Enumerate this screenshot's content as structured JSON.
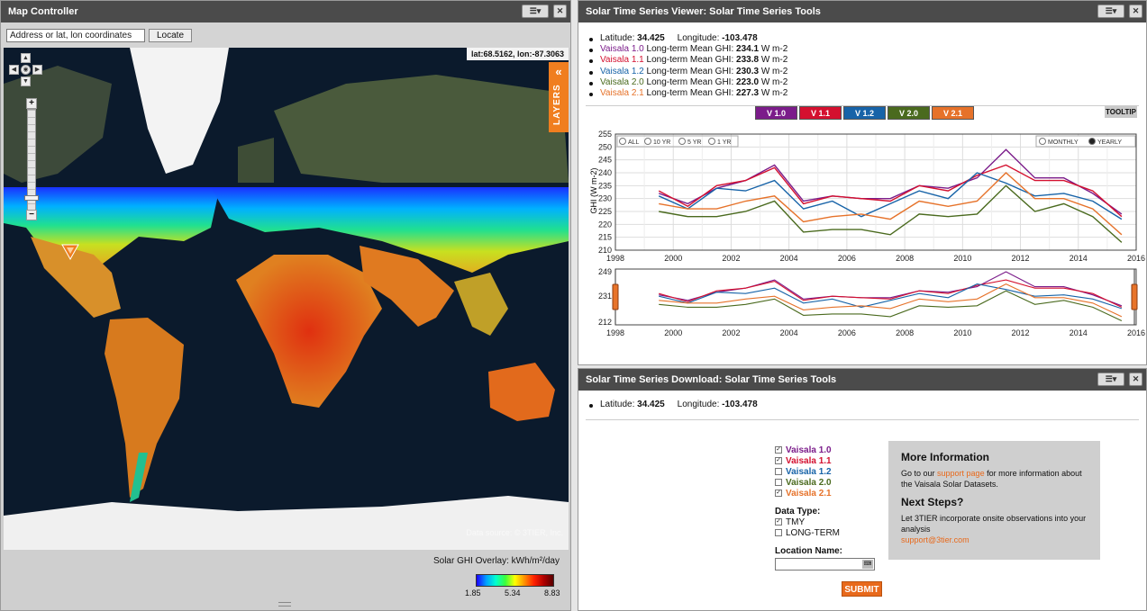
{
  "map_panel": {
    "title": "Map Controller",
    "search_placeholder": "Address or lat, lon coordinates",
    "locate_label": "Locate",
    "coord_readout": "lat:68.5162, lon:-87.3063",
    "layers_label": "LAYERS",
    "layers_chevron": "«",
    "zoom_in": "+",
    "zoom_out": "−",
    "data_source": "Data source: © 3TIER, Inc.",
    "legend": {
      "title": "Solar GHI Overlay: kWh/m²/day",
      "min": "1.85",
      "mid": "5.34",
      "max": "8.83"
    }
  },
  "viewer_panel": {
    "title": "Solar Time Series Viewer: Solar Time Series Tools",
    "latitude_label": "Latitude:",
    "latitude": "34.425",
    "longitude_label": "Longitude:",
    "longitude": "-103.478",
    "ghi_rows": [
      {
        "name": "Vaisala 1.0",
        "label": "Long-term Mean GHI:",
        "value": "234.1",
        "unit": "W m-2",
        "color": "#7b1c8a"
      },
      {
        "name": "Vaisala 1.1",
        "label": "Long-term Mean GHI:",
        "value": "233.8",
        "unit": "W m-2",
        "color": "#d4102f"
      },
      {
        "name": "Vaisala 1.2",
        "label": "Long-term Mean GHI:",
        "value": "230.3",
        "unit": "W m-2",
        "color": "#1763a8"
      },
      {
        "name": "Vaisala 2.0",
        "label": "Long-term Mean GHI:",
        "value": "223.0",
        "unit": "W m-2",
        "color": "#4a6a1e"
      },
      {
        "name": "Vaisala 2.1",
        "label": "Long-term Mean GHI:",
        "value": "227.3",
        "unit": "W m-2",
        "color": "#e6722a"
      }
    ],
    "version_buttons": [
      {
        "label": "V 1.0",
        "color": "#7b1c8a"
      },
      {
        "label": "V 1.1",
        "color": "#d4102f"
      },
      {
        "label": "V 1.2",
        "color": "#1763a8"
      },
      {
        "label": "V 2.0",
        "color": "#4a6a1e"
      },
      {
        "label": "V 2.1",
        "color": "#e6722a"
      }
    ],
    "tooltip_label": "TOOLTIP",
    "range_options": [
      "ALL",
      "10 YR",
      "5 YR",
      "1 YR"
    ],
    "period_options": [
      "MONTHLY",
      "YEARLY"
    ],
    "period_selected": "YEARLY"
  },
  "chart_data": {
    "type": "line",
    "ylabel": "GHI (W m-2)",
    "ylim": [
      210,
      255
    ],
    "yticks": [
      210,
      215,
      220,
      225,
      230,
      235,
      240,
      245,
      250,
      255
    ],
    "xlim": [
      1998,
      2016
    ],
    "xticks": [
      1998,
      2000,
      2002,
      2004,
      2006,
      2008,
      2010,
      2012,
      2014,
      2016
    ],
    "grid": true,
    "nav_yticks": [
      212,
      231,
      249
    ],
    "x": [
      1999.5,
      2000.5,
      2001.5,
      2002.5,
      2003.5,
      2004.5,
      2005.5,
      2006.5,
      2007.5,
      2008.5,
      2009.5,
      2010.5,
      2011.5,
      2012.5,
      2013.5,
      2014.5,
      2015.5
    ],
    "series": [
      {
        "name": "Vaisala 1.0",
        "color": "#7b1c8a",
        "values": [
          232,
          228,
          234,
          237,
          243,
          229,
          231,
          230,
          230,
          235,
          234,
          238,
          249,
          238,
          238,
          232,
          224
        ]
      },
      {
        "name": "Vaisala 1.1",
        "color": "#d4102f",
        "values": [
          233,
          227,
          235,
          237,
          242,
          228,
          231,
          230,
          229,
          235,
          233,
          239,
          243,
          237,
          237,
          233,
          223
        ]
      },
      {
        "name": "Vaisala 1.2",
        "color": "#1763a8",
        "values": [
          231,
          226,
          234,
          233,
          237,
          226,
          229,
          223,
          228,
          233,
          230,
          240,
          236,
          231,
          232,
          229,
          222
        ]
      },
      {
        "name": "Vaisala 2.0",
        "color": "#4a6a1e",
        "values": [
          225,
          223,
          223,
          225,
          229,
          217,
          218,
          218,
          216,
          224,
          223,
          224,
          235,
          225,
          228,
          223,
          213
        ]
      },
      {
        "name": "Vaisala 2.1",
        "color": "#e6722a",
        "values": [
          228,
          226,
          226,
          229,
          231,
          221,
          223,
          224,
          222,
          229,
          227,
          229,
          240,
          230,
          230,
          226,
          216
        ]
      }
    ]
  },
  "download_panel": {
    "title": "Solar Time Series Download: Solar Time Series Tools",
    "latitude_label": "Latitude:",
    "latitude": "34.425",
    "longitude_label": "Longitude:",
    "longitude": "-103.478",
    "datasets": [
      {
        "name": "Vaisala 1.0",
        "checked": true,
        "color": "#7b1c8a"
      },
      {
        "name": "Vaisala 1.1",
        "checked": true,
        "color": "#d4102f"
      },
      {
        "name": "Vaisala 1.2",
        "checked": false,
        "color": "#1763a8"
      },
      {
        "name": "Vaisala 2.0",
        "checked": false,
        "color": "#4a6a1e"
      },
      {
        "name": "Vaisala 2.1",
        "checked": true,
        "color": "#e6722a"
      }
    ],
    "data_type_title": "Data Type:",
    "data_types": [
      {
        "name": "TMY",
        "checked": true
      },
      {
        "name": "LONG-TERM",
        "checked": false
      }
    ],
    "location_title": "Location Name:",
    "submit_label": "SUBMIT",
    "info": {
      "more_title": "More Information",
      "more_pre": "Go to our ",
      "more_link": "support page",
      "more_post": " for more information about the Vaisala Solar Datasets.",
      "next_title": "Next Steps?",
      "next_text": "Let 3TIER incorporate onsite observations into your analysis",
      "email": "support@3tier.com"
    }
  }
}
